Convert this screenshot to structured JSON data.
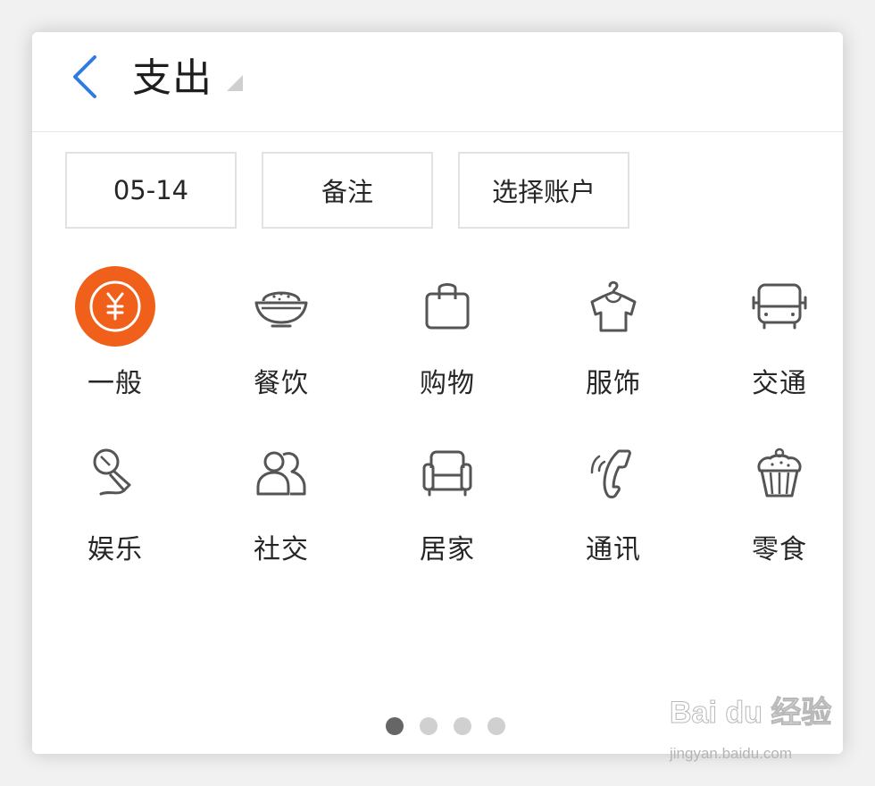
{
  "header": {
    "title": "支出"
  },
  "fields": {
    "date": "05-14",
    "note": "备注",
    "account": "选择账户"
  },
  "categories": [
    {
      "label": "一般",
      "icon": "yuan-coin-icon",
      "selected": true
    },
    {
      "label": "餐饮",
      "icon": "rice-bowl-icon"
    },
    {
      "label": "购物",
      "icon": "shopping-bag-icon"
    },
    {
      "label": "服饰",
      "icon": "shirt-hanger-icon"
    },
    {
      "label": "交通",
      "icon": "bus-icon"
    },
    {
      "label": "娱乐",
      "icon": "microphone-icon"
    },
    {
      "label": "社交",
      "icon": "people-icon"
    },
    {
      "label": "居家",
      "icon": "sofa-icon"
    },
    {
      "label": "通讯",
      "icon": "phone-icon"
    },
    {
      "label": "零食",
      "icon": "cupcake-icon"
    }
  ],
  "pagination": {
    "pages": 4,
    "current": 1
  },
  "colors": {
    "accent": "#f0601a",
    "back_arrow": "#2f7be0",
    "icon_stroke": "#555555"
  },
  "watermark": {
    "brand": "Bai du 经验",
    "url": "jingyan.baidu.com"
  }
}
